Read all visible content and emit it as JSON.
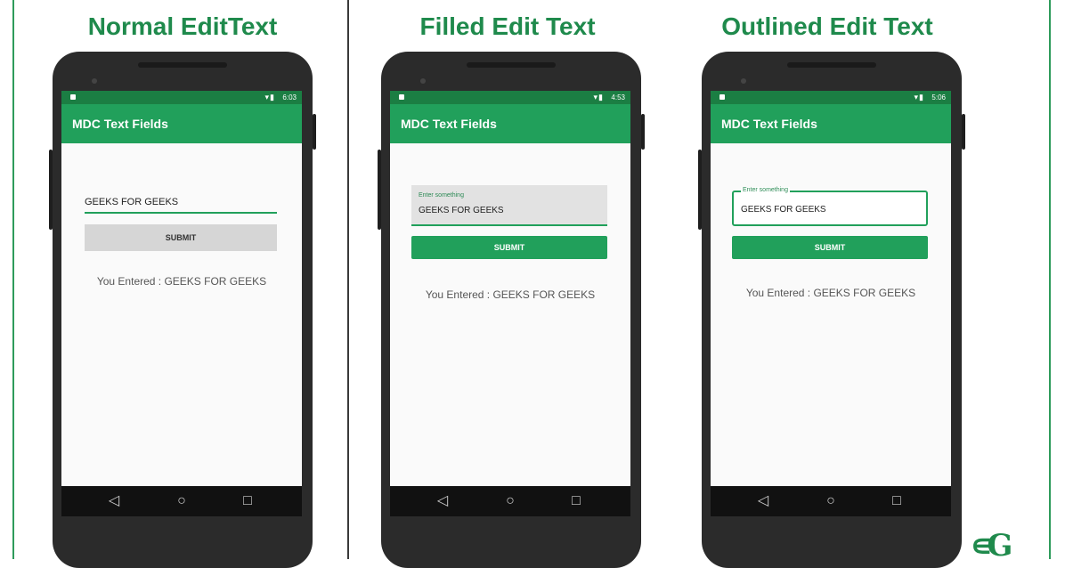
{
  "colors": {
    "brand_green": "#21a05b",
    "status_bar_green": "#1b7e43",
    "title_green": "#1f8a4c",
    "phone_body": "#2b2b2b"
  },
  "sections": [
    {
      "title": "Normal EditText",
      "status_time": "6:03",
      "app_bar_title": "MDC Text Fields",
      "input_value": "GEEKS FOR GEEKS",
      "submit_label": "SUBMIT",
      "result_text": "You Entered : GEEKS FOR GEEKS"
    },
    {
      "title": "Filled Edit Text",
      "status_time": "4:53",
      "app_bar_title": "MDC Text Fields",
      "hint": "Enter something",
      "input_value": "GEEKS FOR GEEKS",
      "submit_label": "SUBMIT",
      "result_text": "You Entered : GEEKS FOR GEEKS"
    },
    {
      "title": "Outlined Edit Text",
      "status_time": "5:06",
      "app_bar_title": "MDC Text Fields",
      "hint": "Enter something",
      "input_value": "GEEKS FOR GEEKS",
      "submit_label": "SUBMIT",
      "result_text": "You Entered : GEEKS FOR GEEKS"
    }
  ],
  "nav_icons": [
    "back-icon",
    "home-icon",
    "recents-icon"
  ],
  "logo": "GfG"
}
